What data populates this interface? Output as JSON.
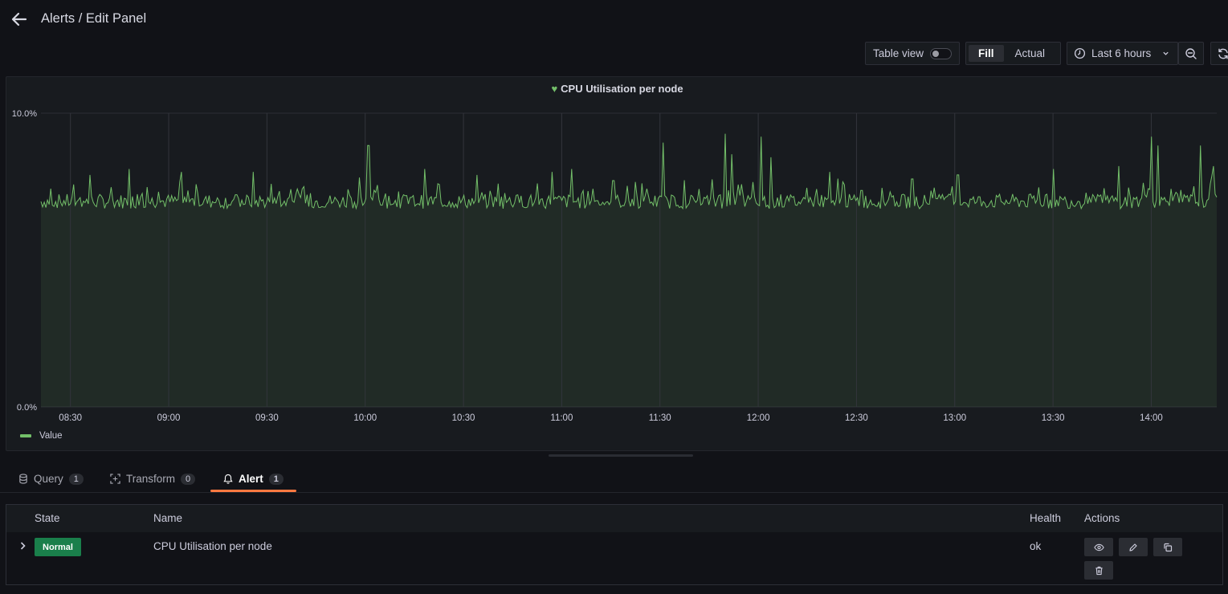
{
  "header": {
    "title": "Alerts / Edit Panel"
  },
  "toolbar": {
    "table_view_label": "Table view",
    "fill_label": "Fill",
    "actual_label": "Actual",
    "time_range": "Last 6 hours"
  },
  "panel": {
    "title": "CPU Utilisation per node"
  },
  "chart_data": {
    "type": "area",
    "title": "CPU Utilisation per node",
    "y_ticks": [
      "10.0%",
      "0.0%"
    ],
    "ylim": [
      0,
      10
    ],
    "unit": "%",
    "x_ticks": [
      "08:30",
      "09:00",
      "09:30",
      "10:00",
      "10:30",
      "11:00",
      "11:30",
      "12:00",
      "12:30",
      "13:00",
      "13:30",
      "14:00"
    ],
    "xlim": [
      "08:21",
      "14:20"
    ],
    "grid": true,
    "legend": "bottom-left",
    "series": [
      {
        "name": "Value",
        "color": "#73bf69",
        "baseline": 7.0,
        "noise": 0.25,
        "peaks": [
          {
            "t": "08:36",
            "v": 7.9
          },
          {
            "t": "08:48",
            "v": 8.1
          },
          {
            "t": "09:04",
            "v": 8.0
          },
          {
            "t": "09:26",
            "v": 8.0
          },
          {
            "t": "10:01",
            "v": 8.9
          },
          {
            "t": "10:18",
            "v": 8.1
          },
          {
            "t": "10:34",
            "v": 7.9
          },
          {
            "t": "10:57",
            "v": 8.0
          },
          {
            "t": "11:03",
            "v": 8.1
          },
          {
            "t": "11:31",
            "v": 9.0
          },
          {
            "t": "11:50",
            "v": 9.3
          },
          {
            "t": "11:52",
            "v": 8.6
          },
          {
            "t": "12:01",
            "v": 9.2
          },
          {
            "t": "12:04",
            "v": 8.5
          },
          {
            "t": "12:22",
            "v": 8.0
          },
          {
            "t": "13:01",
            "v": 7.9
          },
          {
            "t": "13:30",
            "v": 8.1
          },
          {
            "t": "13:50",
            "v": 8.2
          },
          {
            "t": "14:00",
            "v": 9.2
          },
          {
            "t": "14:02",
            "v": 8.9
          },
          {
            "t": "14:15",
            "v": 8.9
          },
          {
            "t": "14:19",
            "v": 8.2
          }
        ]
      }
    ]
  },
  "tabs": [
    {
      "label": "Query",
      "count": "1"
    },
    {
      "label": "Transform",
      "count": "0"
    },
    {
      "label": "Alert",
      "count": "1"
    }
  ],
  "alerts_table": {
    "columns": {
      "state": "State",
      "name": "Name",
      "health": "Health",
      "actions": "Actions"
    },
    "rows": [
      {
        "state": "Normal",
        "name": "CPU Utilisation per node",
        "health": "ok"
      }
    ]
  },
  "colors": {
    "accent_tab": "#ff7941",
    "state_normal": "#1a7f4b",
    "series": "#73bf69"
  }
}
